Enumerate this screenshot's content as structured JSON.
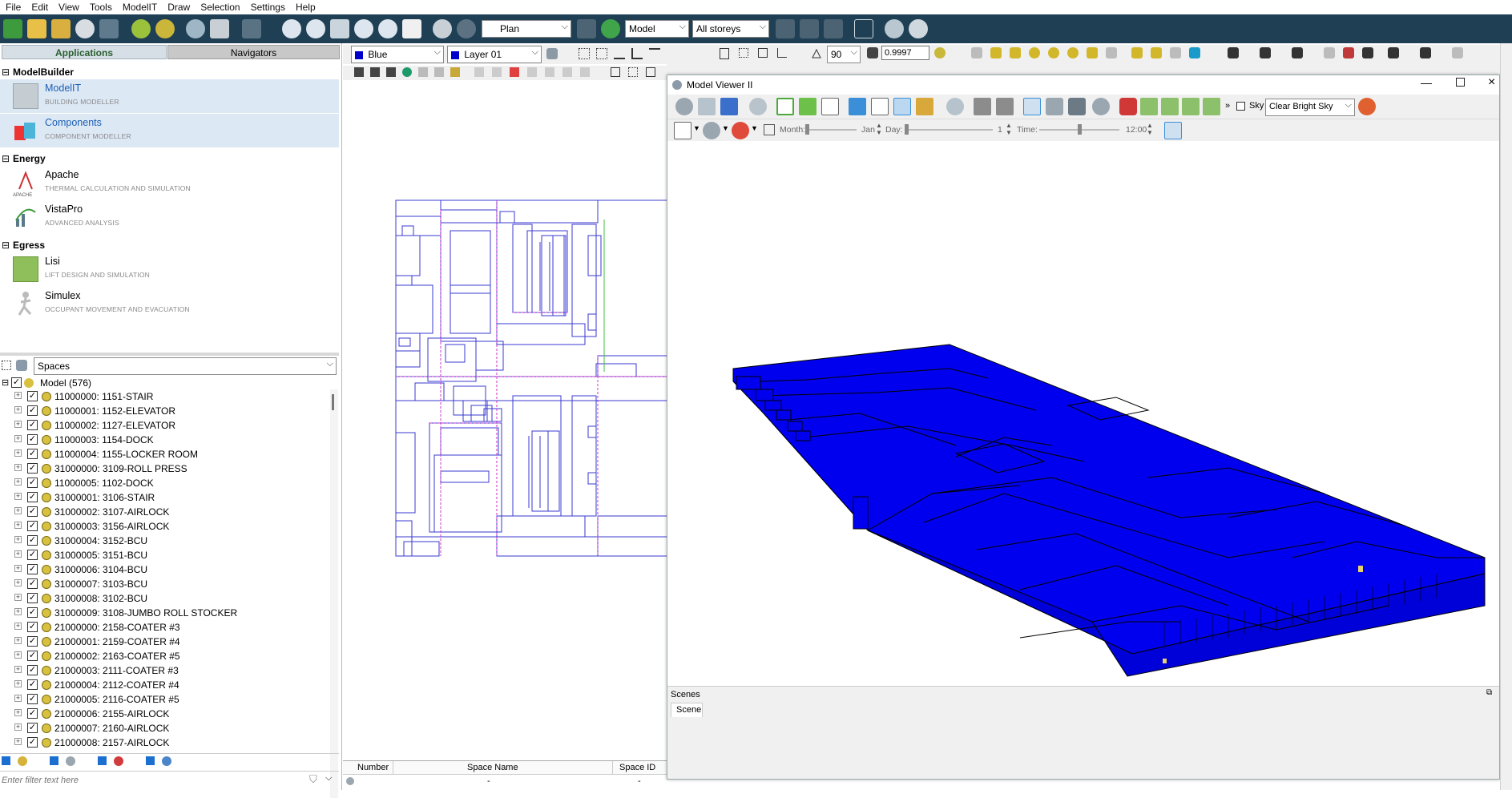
{
  "menu": [
    "File",
    "Edit",
    "View",
    "Tools",
    "ModelIT",
    "Draw",
    "Selection",
    "Settings",
    "Help"
  ],
  "toolbar": {
    "view_mode": "Plan",
    "model_select": "Model",
    "storey_select": "All storeys"
  },
  "center_toolbar": {
    "color_select": "Blue",
    "layer_select": "Layer 01",
    "angle_value": "90",
    "tolerance_value": "0.9997"
  },
  "left_tabs": {
    "applications": "Applications",
    "navigators": "Navigators"
  },
  "groups": {
    "modelbuilder": "ModelBuilder",
    "energy": "Energy",
    "egress": "Egress"
  },
  "apps": {
    "modelit": {
      "name": "ModelIT",
      "desc": "BUILDING MODELLER"
    },
    "components": {
      "name": "Components",
      "desc": "COMPONENT MODELLER"
    },
    "apache": {
      "name": "Apache",
      "desc": "THERMAL CALCULATION AND SIMULATION",
      "icon_caption": "APACHE"
    },
    "vistapro": {
      "name": "VistaPro",
      "desc": "ADVANCED ANALYSIS"
    },
    "lisi": {
      "name": "Lisi",
      "desc": "LIFT DESIGN AND SIMULATION"
    },
    "simulex": {
      "name": "Simulex",
      "desc": "OCCUPANT MOVEMENT AND EVACUATION"
    }
  },
  "navigator": {
    "select": "Spaces",
    "root": "Model (576)"
  },
  "spaces": [
    "11000000: 1151-STAIR",
    "11000001: 1152-ELEVATOR",
    "11000002: 1127-ELEVATOR",
    "11000003: 1154-DOCK",
    "11000004: 1155-LOCKER ROOM",
    "31000000: 3109-ROLL PRESS",
    "11000005: 1102-DOCK",
    "31000001: 3106-STAIR",
    "31000002: 3107-AIRLOCK",
    "31000003: 3156-AIRLOCK",
    "31000004: 3152-BCU",
    "31000005: 3151-BCU",
    "31000006: 3104-BCU",
    "31000007: 3103-BCU",
    "31000008: 3102-BCU",
    "31000009: 3108-JUMBO ROLL STOCKER",
    "21000000: 2158-COATER #3",
    "21000001: 2159-COATER #4",
    "21000002: 2163-COATER #5",
    "21000003: 2111-COATER #3",
    "21000004: 2112-COATER #4",
    "21000005: 2116-COATER #5",
    "21000006: 2155-AIRLOCK",
    "21000007: 2160-AIRLOCK",
    "21000008: 2157-AIRLOCK"
  ],
  "filter": {
    "placeholder": "Enter filter text here"
  },
  "table": {
    "headers": [
      "Number",
      "Space Name",
      "Space ID"
    ],
    "row": [
      "",
      "-",
      "-"
    ]
  },
  "viewer": {
    "title": "Model Viewer II",
    "sky_label": "Sky",
    "sky_select": "Clear Bright Sky",
    "month_label": "Month:",
    "month_value": "Jan",
    "day_label": "Day:",
    "day_value": "1",
    "time_label": "Time:",
    "time_value": "12:00",
    "scenes_label": "Scenes",
    "scene_tab": "Scene"
  },
  "colors": {
    "toolbar_bg": "#1f3f55",
    "model_blue": "#0000ee",
    "plan_blue": "#3a3ad0",
    "plan_magenta": "#cc33cc"
  }
}
